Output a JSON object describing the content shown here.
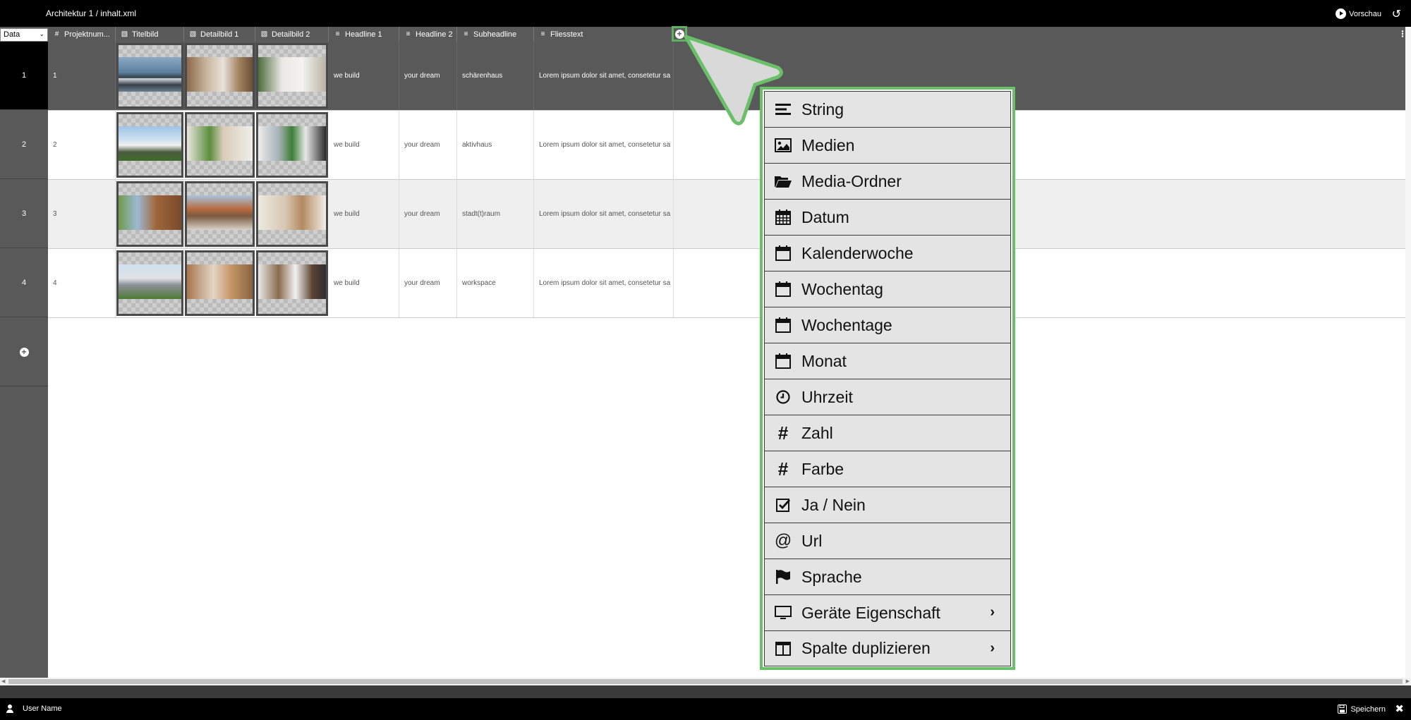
{
  "app": {
    "title": "Architektur 1 / inhalt.xml",
    "preview_label": "Vorschau"
  },
  "rail": {
    "select_value": "Data",
    "rows": [
      "1",
      "2",
      "3",
      "4"
    ]
  },
  "columns": [
    {
      "label": "Projektnum...",
      "icon": "hash-icon"
    },
    {
      "label": "Titelbild",
      "icon": "image-icon"
    },
    {
      "label": "Detailbild 1",
      "icon": "image-icon"
    },
    {
      "label": "Detailbild 2",
      "icon": "image-icon"
    },
    {
      "label": "Headline 1",
      "icon": "text-lines-icon"
    },
    {
      "label": "Headline 2",
      "icon": "text-lines-icon"
    },
    {
      "label": "Subheadline",
      "icon": "text-lines-icon"
    },
    {
      "label": "Fliesstext",
      "icon": "text-lines-icon"
    }
  ],
  "rows": [
    {
      "num": "1",
      "h1": "we build",
      "h2": "your dream",
      "sub": "schärenhaus",
      "text": "Lorem ipsum dolor sit amet, consetetur sa"
    },
    {
      "num": "2",
      "h1": "we build",
      "h2": "your dream",
      "sub": "aktivhaus",
      "text": "Lorem ipsum dolor sit amet, consetetur sa"
    },
    {
      "num": "3",
      "h1": "we build",
      "h2": "your dream",
      "sub": "stadt(t)raum",
      "text": "Lorem ipsum dolor sit amet, consetetur sa"
    },
    {
      "num": "4",
      "h1": "we build",
      "h2": "your dream",
      "sub": "workspace",
      "text": "Lorem ipsum dolor sit amet, consetetur sa"
    }
  ],
  "menu": {
    "items": [
      {
        "label": "String",
        "icon": "text-lines-icon"
      },
      {
        "label": "Medien",
        "icon": "image-icon"
      },
      {
        "label": "Media-Ordner",
        "icon": "folder-open-icon"
      },
      {
        "label": "Datum",
        "icon": "calendar-grid-icon"
      },
      {
        "label": "Kalenderwoche",
        "icon": "calendar-icon"
      },
      {
        "label": "Wochentag",
        "icon": "calendar-icon"
      },
      {
        "label": "Wochentage",
        "icon": "calendar-icon"
      },
      {
        "label": "Monat",
        "icon": "calendar-icon"
      },
      {
        "label": "Uhrzeit",
        "icon": "clock-icon"
      },
      {
        "label": "Zahl",
        "icon": "hash-icon"
      },
      {
        "label": "Farbe",
        "icon": "hash-icon"
      },
      {
        "label": "Ja / Nein",
        "icon": "checkbox-icon"
      },
      {
        "label": "Url",
        "icon": "at-icon"
      },
      {
        "label": "Sprache",
        "icon": "flag-icon"
      },
      {
        "label": "Geräte Eigenschaft",
        "icon": "monitor-icon",
        "submenu": true
      },
      {
        "label": "Spalte duplizieren",
        "icon": "columns-icon",
        "submenu": true
      }
    ]
  },
  "footer": {
    "user_name": "User Name",
    "save_label": "Speichern"
  },
  "colors": {
    "accent_green": "#6abf69",
    "bar_black": "#000000",
    "rail_gray": "#595959"
  }
}
